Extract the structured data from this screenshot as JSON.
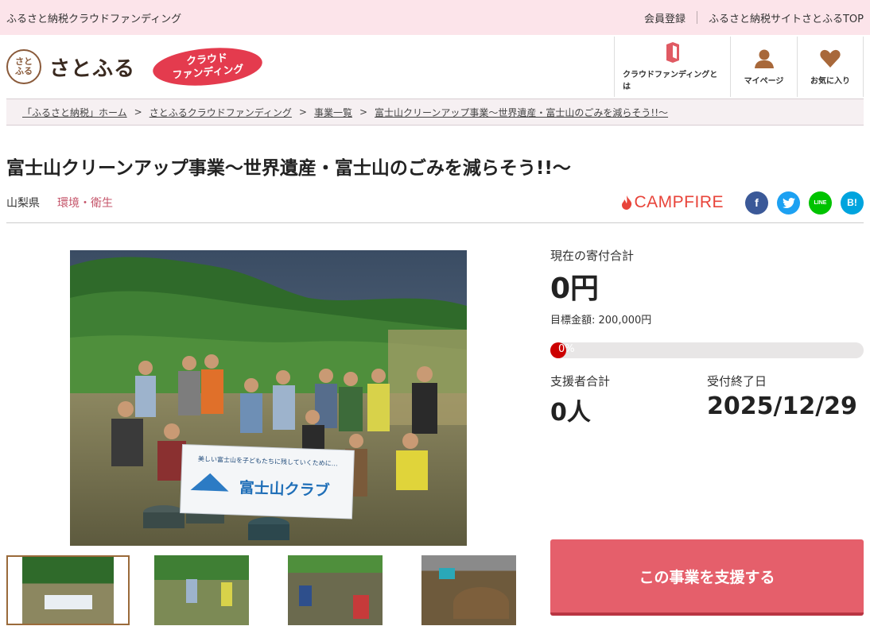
{
  "topbar": {
    "site_name": "ふるさと納税クラウドファンディング",
    "links": [
      "会員登録",
      "ふるさと納税サイトさとふるTOP"
    ]
  },
  "header": {
    "logo_seal": "さと\nふる",
    "logo_text": "さとふる",
    "badge_line1": "クラウド",
    "badge_line2": "ファンディング",
    "nav": [
      {
        "label": "クラウドファンディングとは",
        "icon": "book-icon"
      },
      {
        "label": "マイページ",
        "icon": "person-icon"
      },
      {
        "label": "お気に入り",
        "icon": "heart-icon"
      }
    ]
  },
  "breadcrumb": [
    "「ふるさと納税」ホーム",
    "さとふるクラウドファンディング",
    "事業一覧",
    "富士山クリーンアップ事業〜世界遺産・富士山のごみを減らそう!!〜"
  ],
  "project": {
    "title": "富士山クリーンアップ事業〜世界遺産・富士山のごみを減らそう!!〜",
    "prefecture": "山梨県",
    "category": "環境・衛生",
    "partner": "CAMPFIRE",
    "share": [
      {
        "name": "facebook-icon",
        "glyph": "f",
        "color": "#3b5998"
      },
      {
        "name": "twitter-icon",
        "glyph": "t",
        "color": "#1da1f2"
      },
      {
        "name": "line-icon",
        "glyph": "LINE",
        "color": "#00c300"
      },
      {
        "name": "hatena-icon",
        "glyph": "B!",
        "color": "#00a4de"
      }
    ],
    "banner_sub": "美しい富士山を子どもたちに残していくために…",
    "banner_main": "富士山クラブ"
  },
  "stats": {
    "total_label": "現在の寄付合計",
    "total_value": "0円",
    "goal_text": "目標金額: 200,000円",
    "progress_text": "0%",
    "progress": 0,
    "supporters_label": "支援者合計",
    "supporters_value": "0人",
    "deadline_label": "受付終了日",
    "deadline_value": "2025/12/29"
  },
  "cta": {
    "label": "この事業を支援する"
  }
}
